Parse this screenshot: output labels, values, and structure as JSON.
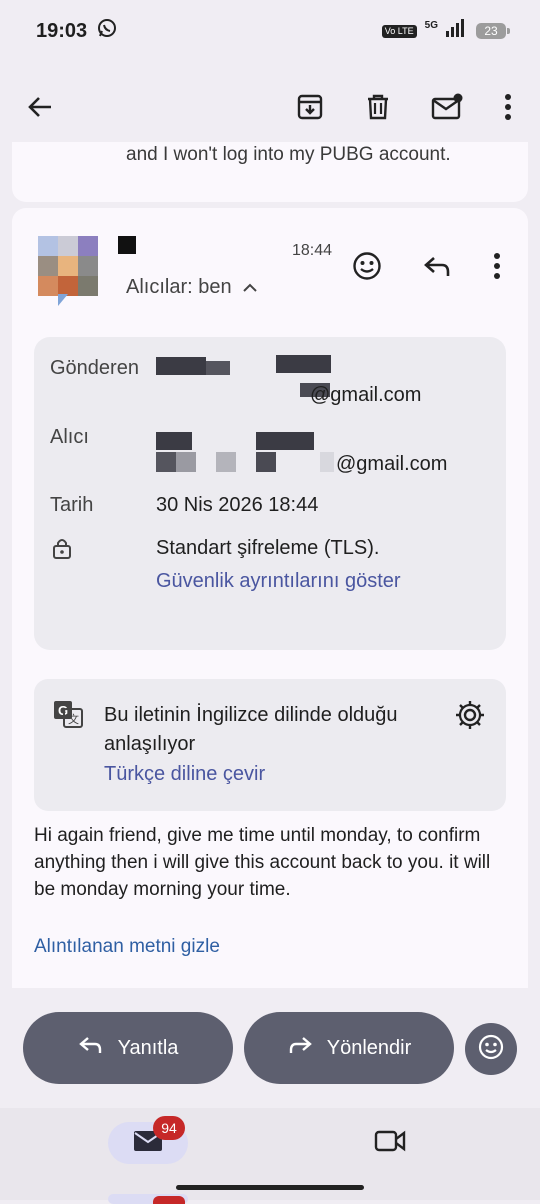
{
  "status_bar": {
    "time": "19:03",
    "volte_label": "Vo LTE",
    "network": "5G",
    "battery": "23"
  },
  "toolbar": {
    "icons": [
      "back-arrow-icon",
      "archive-icon",
      "delete-icon",
      "mark-unread-icon",
      "more-vert-icon"
    ]
  },
  "previous_message": {
    "snippet": "and I won't log into my PUBG account."
  },
  "message": {
    "time": "18:44",
    "recipients_label": "Alıcılar: ben",
    "details": {
      "from_label": "Gönderen",
      "from_value": "@gmail.com",
      "to_label": "Alıcı",
      "to_value": "@gmail.com",
      "date_label": "Tarih",
      "date_value": "30 Nis 2026 18:44",
      "encryption_value": "Standart şifreleme (TLS).",
      "security_link": "Güvenlik ayrıntılarını göster"
    },
    "translate": {
      "text": "Bu iletinin İngilizce dilinde olduğu anlaşılıyor",
      "link": "Türkçe diline çevir"
    },
    "body": "Hi again friend, give me time until monday, to confirm anything then i will give this account back to you. it will be monday morning your time.",
    "quoted_link": "Alıntılanan metni gizle"
  },
  "actions": {
    "reply_label": "Yanıtla",
    "forward_label": "Yönlendir"
  },
  "bottom_nav": {
    "mail_badge": "94"
  },
  "colors": {
    "accent_link": "#4a56a0",
    "action_button": "#5d5f6f",
    "badge": "#c62828"
  }
}
